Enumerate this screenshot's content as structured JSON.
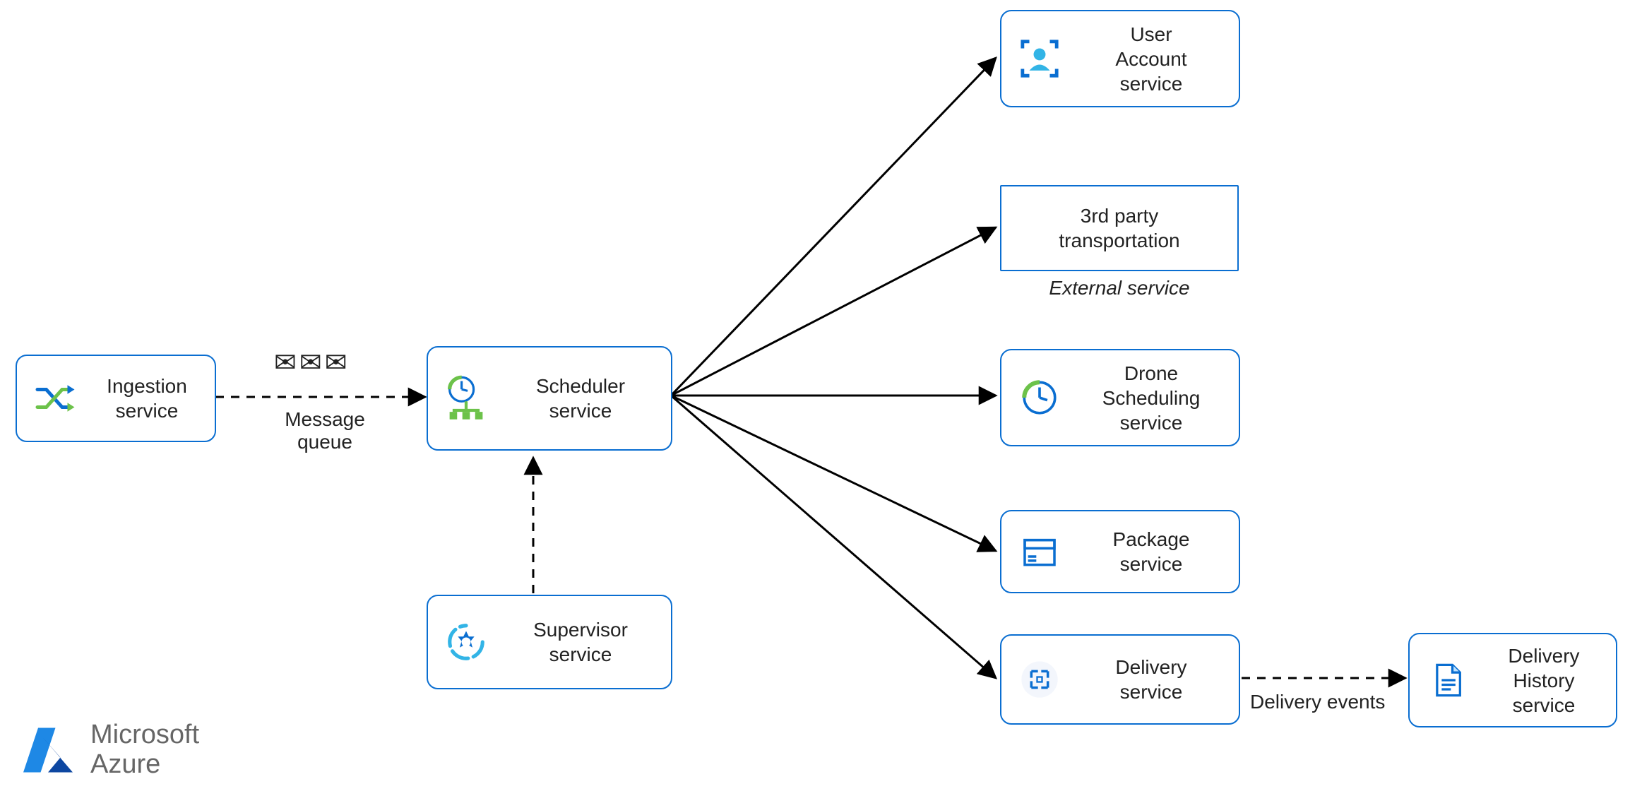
{
  "nodes": {
    "ingestion": {
      "label": "Ingestion\nservice"
    },
    "scheduler": {
      "label": "Scheduler\nservice"
    },
    "supervisor": {
      "label": "Supervisor\nservice"
    },
    "user": {
      "label": "User\nAccount\nservice"
    },
    "thirdparty": {
      "label": "3rd party\ntransportation"
    },
    "drone": {
      "label": "Drone\nScheduling\nservice"
    },
    "package": {
      "label": "Package\nservice"
    },
    "delivery": {
      "label": "Delivery\nservice"
    },
    "history": {
      "label": "Delivery\nHistory\nservice"
    }
  },
  "captions": {
    "queue": "Message\nqueue",
    "external": "External service",
    "events": "Delivery events"
  },
  "branding": {
    "line1": "Microsoft",
    "line2": "Azure"
  }
}
